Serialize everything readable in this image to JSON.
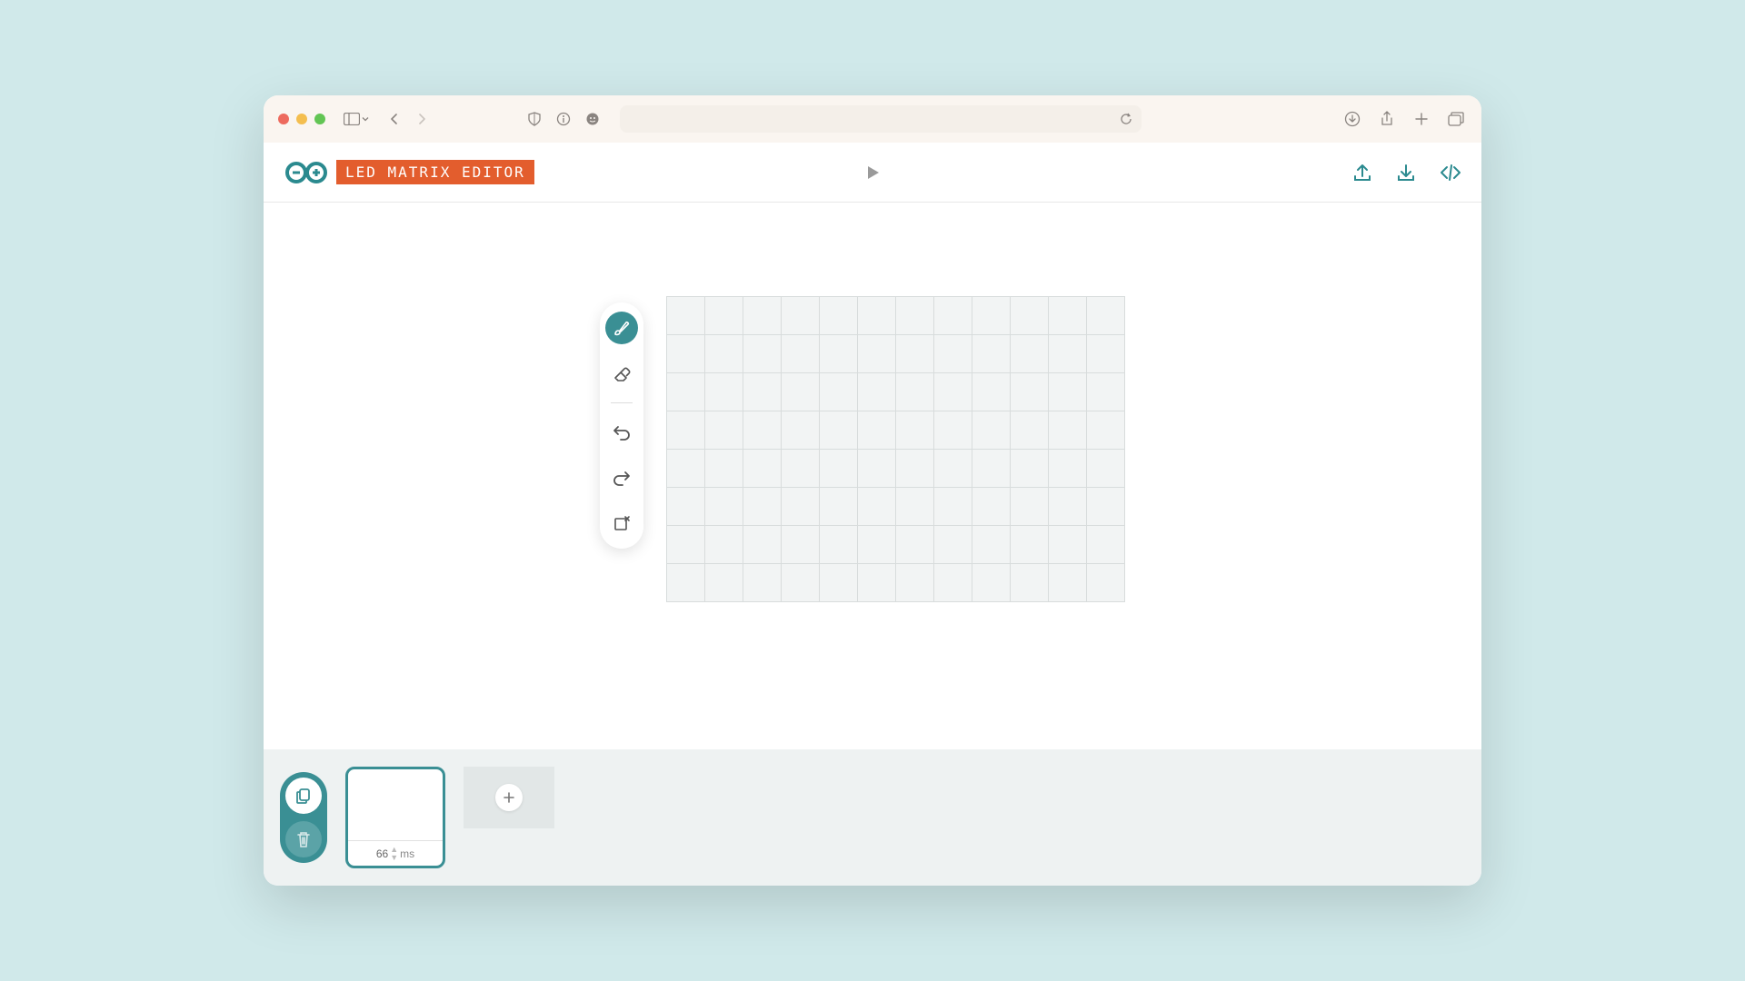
{
  "app": {
    "title": "LED MATRIX EDITOR"
  },
  "grid": {
    "cols": 12,
    "rows": 8
  },
  "tools": {
    "draw": "draw-tool",
    "erase": "erase-tool",
    "undo": "undo",
    "redo": "redo",
    "clear": "clear-frame"
  },
  "header": {
    "play": "play",
    "upload": "upload",
    "download": "download",
    "code": "code-view"
  },
  "timeline": {
    "duplicate": "duplicate-frame",
    "delete": "delete-frame",
    "add": "add-frame",
    "frames": [
      {
        "duration_value": "66",
        "duration_unit": "ms"
      }
    ]
  },
  "browser": {
    "address": "",
    "refresh": "refresh"
  },
  "colors": {
    "accent": "#3a8f94",
    "brand_orange": "#e35d2d"
  }
}
